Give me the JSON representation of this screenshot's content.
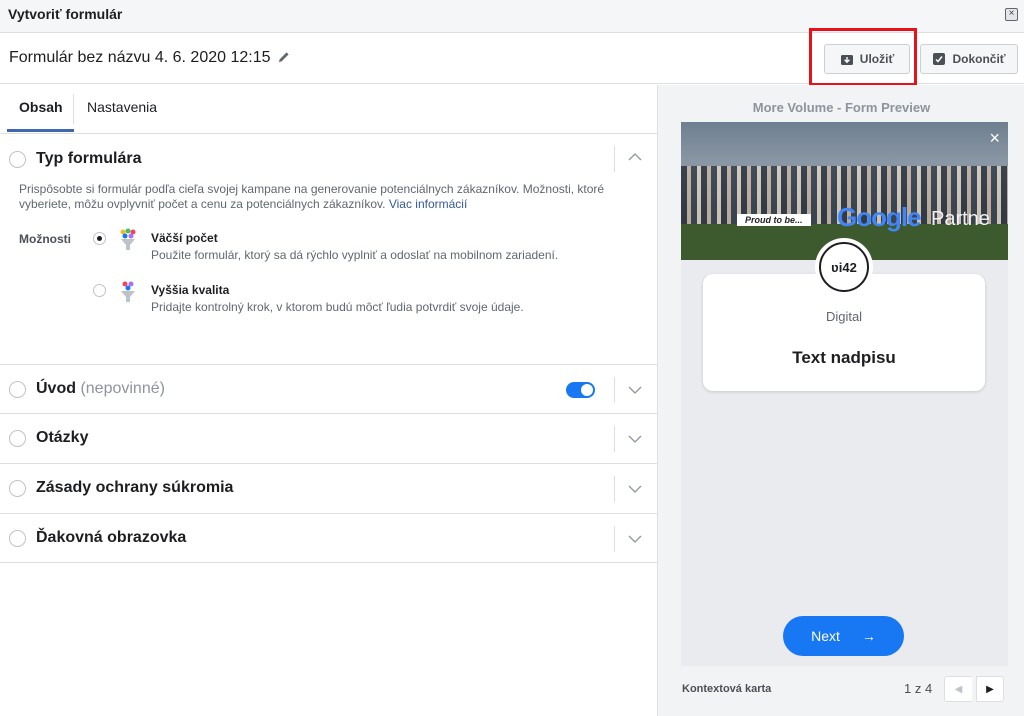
{
  "window": {
    "title": "Vytvoriť formulár",
    "close_glyph": "×"
  },
  "header": {
    "form_name": "Formulár bez názvu 4. 6. 2020 12:15",
    "save_label": "Uložiť",
    "finish_label": "Dokončiť"
  },
  "tabs": {
    "content": "Obsah",
    "settings": "Nastavenia"
  },
  "sections": {
    "form_type": {
      "title": "Typ formulára",
      "description": "Prispôsobte si formulár podľa cieľa svojej kampane na generovanie potenciálnych zákazníkov. Možnosti, ktoré vyberiete, môžu ovplyvniť počet a cenu za potenciálnych zákazníkov.",
      "learn_more": "Viac informácií",
      "options_label": "Možnosti",
      "options": [
        {
          "title": "Väčší počet",
          "description": "Použite formulár, ktorý sa dá rýchlo vyplniť a odoslať na mobilnom zariadení.",
          "selected": true
        },
        {
          "title": "Vyššia kvalita",
          "description": "Pridajte kontrolný krok, v ktorom budú môcť ľudia potvrdiť svoje údaje.",
          "selected": false
        }
      ]
    },
    "intro": {
      "title": "Úvod",
      "subtitle": "(nepovinné)",
      "toggle_on": true
    },
    "questions": {
      "title": "Otázky"
    },
    "privacy": {
      "title": "Zásady ochrany súkromia"
    },
    "thank_you": {
      "title": "Ďakovná obrazovka"
    }
  },
  "preview": {
    "label": "More Volume - Form Preview",
    "hero": {
      "banner_text": "Proud to be...",
      "brand_text": "Google",
      "partner_text": "Partne"
    },
    "logo_text": "ʋi42",
    "company": "Digital",
    "headline": "Text nadpisu",
    "next_label": "Next",
    "next_arrow": "→",
    "footer_label": "Kontextová karta",
    "pager": "1 z 4",
    "prev_glyph": "◀",
    "next_glyph": "▶"
  },
  "colors": {
    "accent": "#1877f2",
    "tab_underline": "#4267b2",
    "highlight": "#e8101a"
  }
}
